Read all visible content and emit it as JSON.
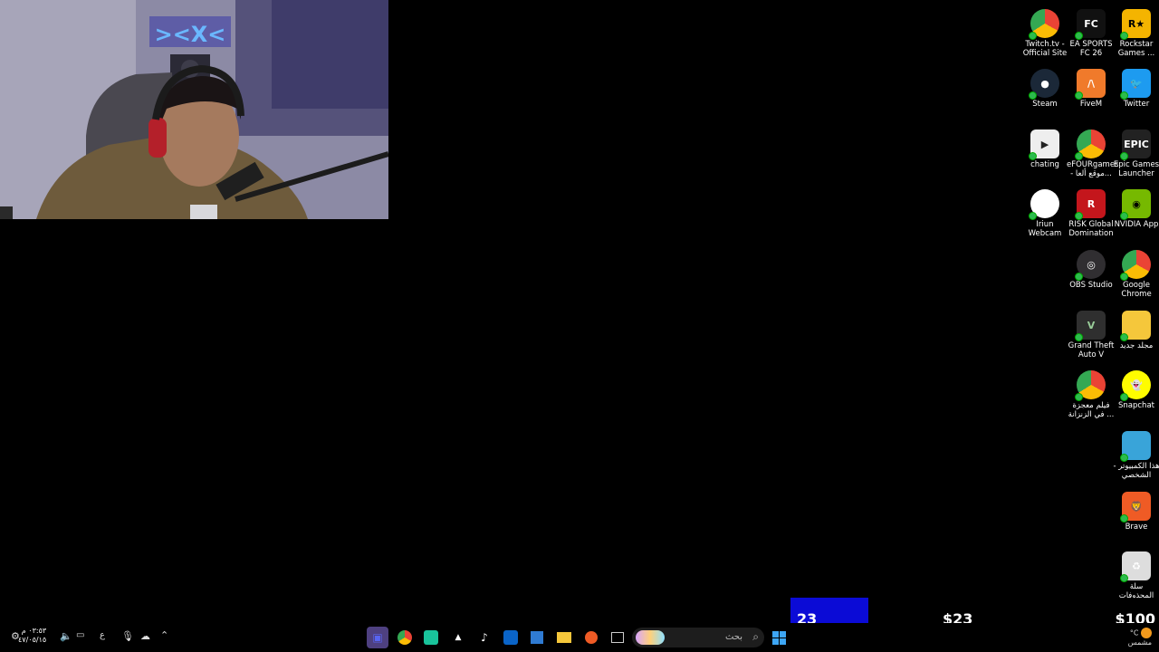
{
  "desktop_icons": [
    {
      "label": "Twitch.tv - Official Site",
      "icon": "chrome-icon"
    },
    {
      "label": "EA SPORTS FC 26",
      "icon": "fc26-icon"
    },
    {
      "label": "Rockstar Games ...",
      "icon": "rockstar-icon"
    },
    {
      "label": "Steam",
      "icon": "steam-icon"
    },
    {
      "label": "FiveM",
      "icon": "fivem-icon"
    },
    {
      "label": "Twitter",
      "icon": "twitter-icon"
    },
    {
      "label": "chating",
      "icon": "video-file-icon"
    },
    {
      "label": "eFOURgames - موقع ألعا...",
      "icon": "chrome-icon"
    },
    {
      "label": "Epic Games Launcher",
      "icon": "epic-icon"
    },
    {
      "label": "Iriun Webcam",
      "icon": "iriun-icon"
    },
    {
      "label": "RISK Global Domination",
      "icon": "risk-icon"
    },
    {
      "label": "NVIDIA App",
      "icon": "nvidia-icon"
    },
    {
      "label": "OBS Studio",
      "icon": "obs-icon"
    },
    {
      "label": "Google Chrome",
      "icon": "chrome-icon"
    },
    {
      "label": "Grand Theft Auto V",
      "icon": "gta-icon"
    },
    {
      "label": "مجلد جديد",
      "icon": "folder-icon"
    },
    {
      "label": "فيلم معجزة في الزنزانة ...",
      "icon": "chrome-icon"
    },
    {
      "label": "Snapchat",
      "icon": "snapchat-icon"
    },
    {
      "label": "هذا الكمبيوتر - الشخصي",
      "icon": "monitor-icon"
    },
    {
      "label": "Brave",
      "icon": "brave-icon"
    },
    {
      "label": "سلة المحذوفات",
      "icon": "recycle-bin-icon"
    }
  ],
  "goal_bar": {
    "count": "23",
    "current": "$23",
    "target": "$100",
    "progress_fraction": 0.23,
    "fill_color": "#0b0bd6"
  },
  "taskbar": {
    "search_placeholder": "بحث",
    "clock_time": "٠٣:٥٣ م",
    "clock_date": "٤٧/٠٥/١٥",
    "weather_temp": "°C",
    "weather_desc": "مشمس",
    "lang": "ع"
  }
}
